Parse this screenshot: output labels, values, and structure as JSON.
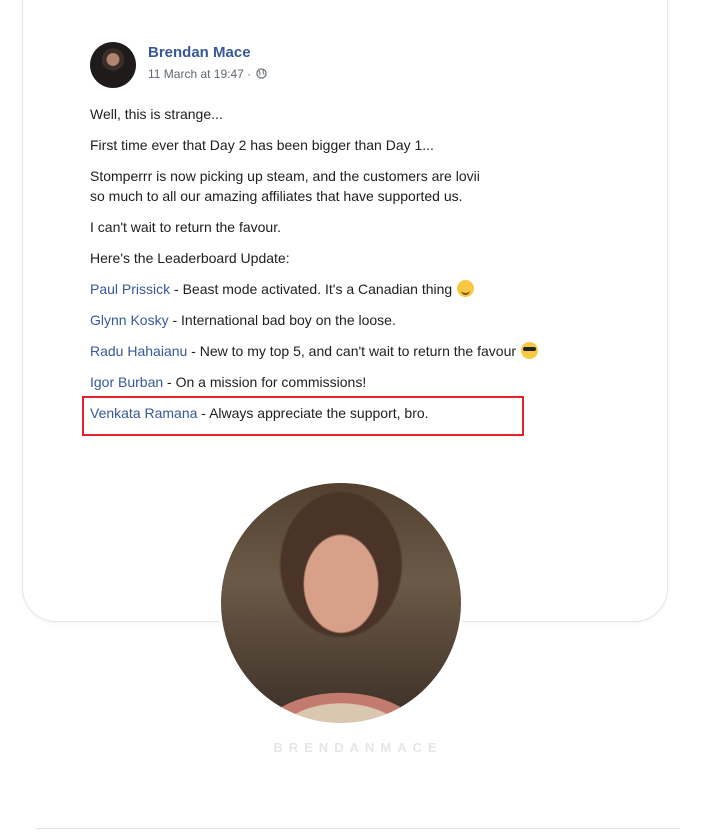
{
  "post": {
    "author": "Brendan Mace",
    "timestamp": "11 March at 19:47 ·",
    "lines": [
      "Well, this is strange...",
      "First time ever that Day 2 has been bigger than Day 1...",
      "Stomperrr is now picking up steam, and the customers are lovii",
      "so much to all our amazing affiliates that have supported us.",
      "I can't wait to return the favour.",
      "Here's the Leaderboard Update:"
    ],
    "leaderboard": [
      {
        "name": "Paul Prissick",
        "text": " - Beast mode activated. It's a Canadian thing",
        "emoji": "winking-face-icon"
      },
      {
        "name": "Glynn Kosky",
        "text": " - International bad boy on the loose.",
        "emoji": ""
      },
      {
        "name": "Radu Hahaianu",
        "text": " - New to my top 5, and can't wait to return  the favour",
        "emoji": "sunglasses-face-icon"
      },
      {
        "name": "Igor Burban",
        "text": " - On a mission for commissions!",
        "emoji": ""
      },
      {
        "name": "Venkata Ramana",
        "text": " - Always appreciate the support, bro.",
        "emoji": ""
      }
    ],
    "highlight_color": "#e3242b"
  },
  "profile": {
    "watermark": "BRENDANMACE"
  }
}
